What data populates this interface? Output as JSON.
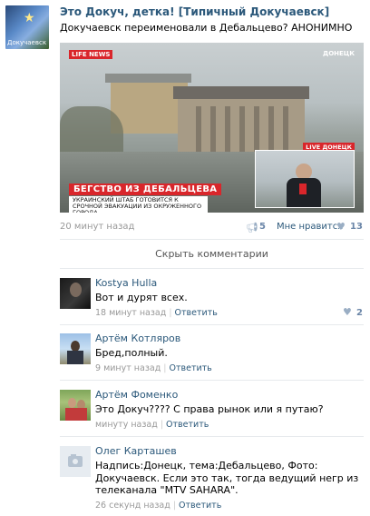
{
  "post": {
    "group_name": "Это Докуч, детка! [Типичный Докучаевск]",
    "text": "Докучаевск переименовали в Дебальцево? АНОНИМНО",
    "avatar_caption": "Докучаевск",
    "image": {
      "channel_logo": "LIFE NEWS",
      "location_tag": "ДОНЕЦК",
      "inset_tag": "LIVE ДОНЕЦК",
      "banner": "БЕГСТВО ИЗ ДЕБАЛЬЦЕВА",
      "subbanner": "УКРАИНСКИЙ ШТАБ ГОТОВИТСЯ К СРОЧНОЙ ЭВАКУАЦИИ ИЗ ОКРУЖЕННОГО ГОРОДА"
    },
    "time": "20 минут назад",
    "reposts": "5",
    "like_label": "Мне нравится",
    "likes": "13",
    "icons": {
      "repost": "megaphone-icon",
      "like": "heart-icon"
    }
  },
  "hide_comments": "Скрыть комментарии",
  "comments": [
    {
      "name": "Kostya Hulla",
      "text": "Вот и дурят всех.",
      "time": "18 минут назад",
      "reply": "Ответить",
      "likes": "2"
    },
    {
      "name": "Артём Котляров",
      "text": "Бред,полный.",
      "time": "9 минут назад",
      "reply": "Ответить"
    },
    {
      "name": "Артём Фоменко",
      "text": "Это Докуч???? С права рынок или я путаю?",
      "time": "минуту назад",
      "reply": "Ответить"
    },
    {
      "name": "Олег Карташев",
      "text": "Надпись:Донецк, тема:Дебальцево, Фото: Докучаевск. Если это так, тогда ведущий негр из телеканала \"MTV SAHARA\".",
      "time": "26 секунд назад",
      "reply": "Ответить"
    }
  ],
  "colors": {
    "link": "#2b587a",
    "meta": "#999999",
    "banner_red": "#d9262b"
  }
}
